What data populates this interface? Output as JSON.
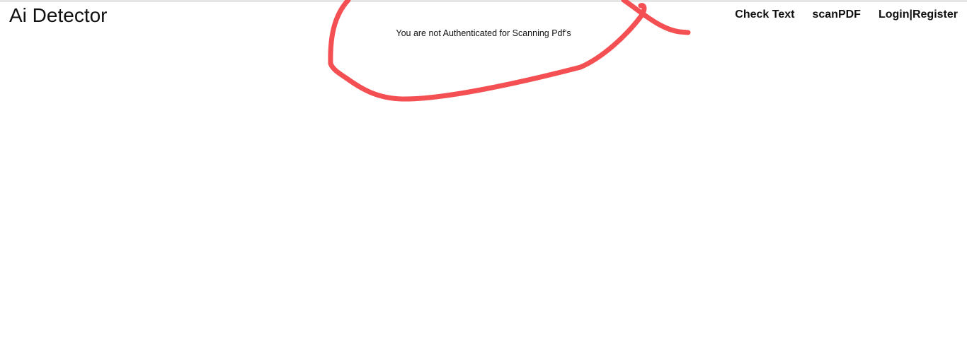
{
  "header": {
    "brand": "Ai Detector",
    "nav": {
      "check_text": "Check Text",
      "scan_pdf": "scanPDF",
      "login_register": "Login|Register"
    }
  },
  "main": {
    "message": "You are not Authenticated for Scanning Pdf's"
  },
  "colors": {
    "annotation_red": "#f44f52",
    "top_border": "#e6e6e6"
  }
}
